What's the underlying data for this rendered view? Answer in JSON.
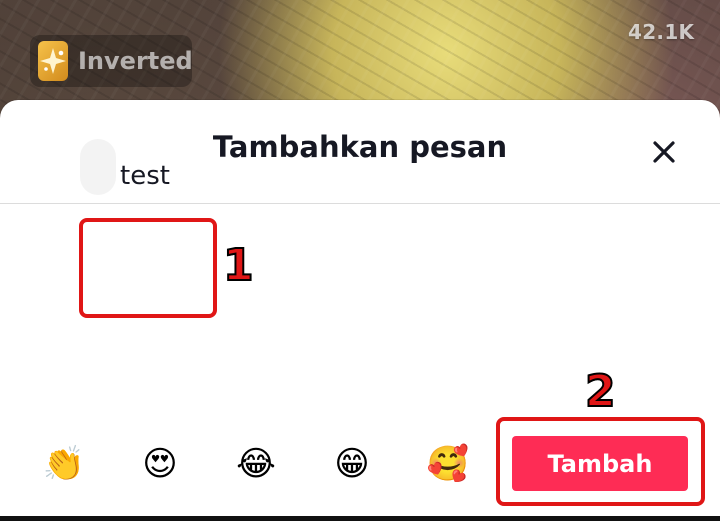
{
  "background": {
    "view_count": "42.1K",
    "effect": {
      "label": "Inverted",
      "icon": "sparkle-star-icon",
      "accent": "#f6c24a"
    }
  },
  "sheet": {
    "title": "Tambahkan pesan",
    "close_icon": "close-icon"
  },
  "message": {
    "value": "test"
  },
  "emoji_bar": [
    {
      "name": "clapping-hands-emoji",
      "glyph": "👏"
    },
    {
      "name": "heart-eyes-emoji",
      "glyph": "😍"
    },
    {
      "name": "tears-of-joy-emoji",
      "glyph": "😂"
    },
    {
      "name": "grinning-teeth-emoji",
      "glyph": "😁"
    },
    {
      "name": "smiling-hearts-emoji",
      "glyph": "🥰"
    }
  ],
  "actions": {
    "submit_label": "Tambah",
    "submit_color": "#fe2c55"
  },
  "annotations": {
    "step_1": "1",
    "step_2": "2",
    "color": "#e01616"
  }
}
